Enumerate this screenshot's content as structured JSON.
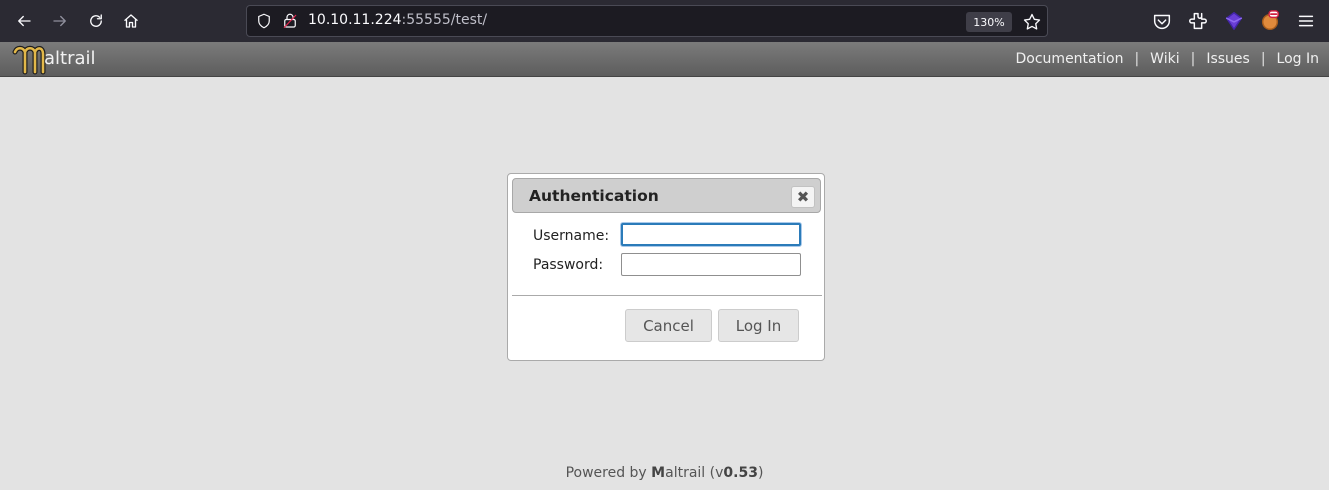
{
  "browser": {
    "url_host": "10.10.11.224",
    "url_rest": ":55555/test/",
    "zoom": "130%"
  },
  "app": {
    "logo_text": "altrail",
    "nav_links": [
      "Documentation",
      "Wiki",
      "Issues",
      "Log In"
    ]
  },
  "dialog": {
    "title": "Authentication",
    "close_symbol": "✖",
    "username_label": "Username:",
    "password_label": "Password:",
    "username_value": "",
    "password_value": "",
    "cancel_label": "Cancel",
    "login_label": "Log In"
  },
  "footer": {
    "prefix": "Powered by ",
    "brand_bold": "M",
    "brand_rest": "altrail",
    "version_open": " (v",
    "version": "0.53",
    "version_close": ")"
  },
  "icons": {
    "back": "arrow-left-icon",
    "forward": "arrow-right-icon",
    "reload": "reload-icon",
    "home": "home-icon",
    "shield": "shield-icon",
    "lock": "insecure-lock-icon",
    "bookmark": "star-icon",
    "pocket": "pocket-icon",
    "extensions": "puzzle-icon",
    "extension_a": "purple-cube-icon",
    "extension_b": "fox-avatar-icon",
    "menu": "hamburger-menu-icon"
  },
  "colors": {
    "browser_bg": "#2b2a33",
    "header_bg": "#6b6b6b",
    "page_bg": "#e3e3e3",
    "focus_ring": "#2b7bb9"
  }
}
